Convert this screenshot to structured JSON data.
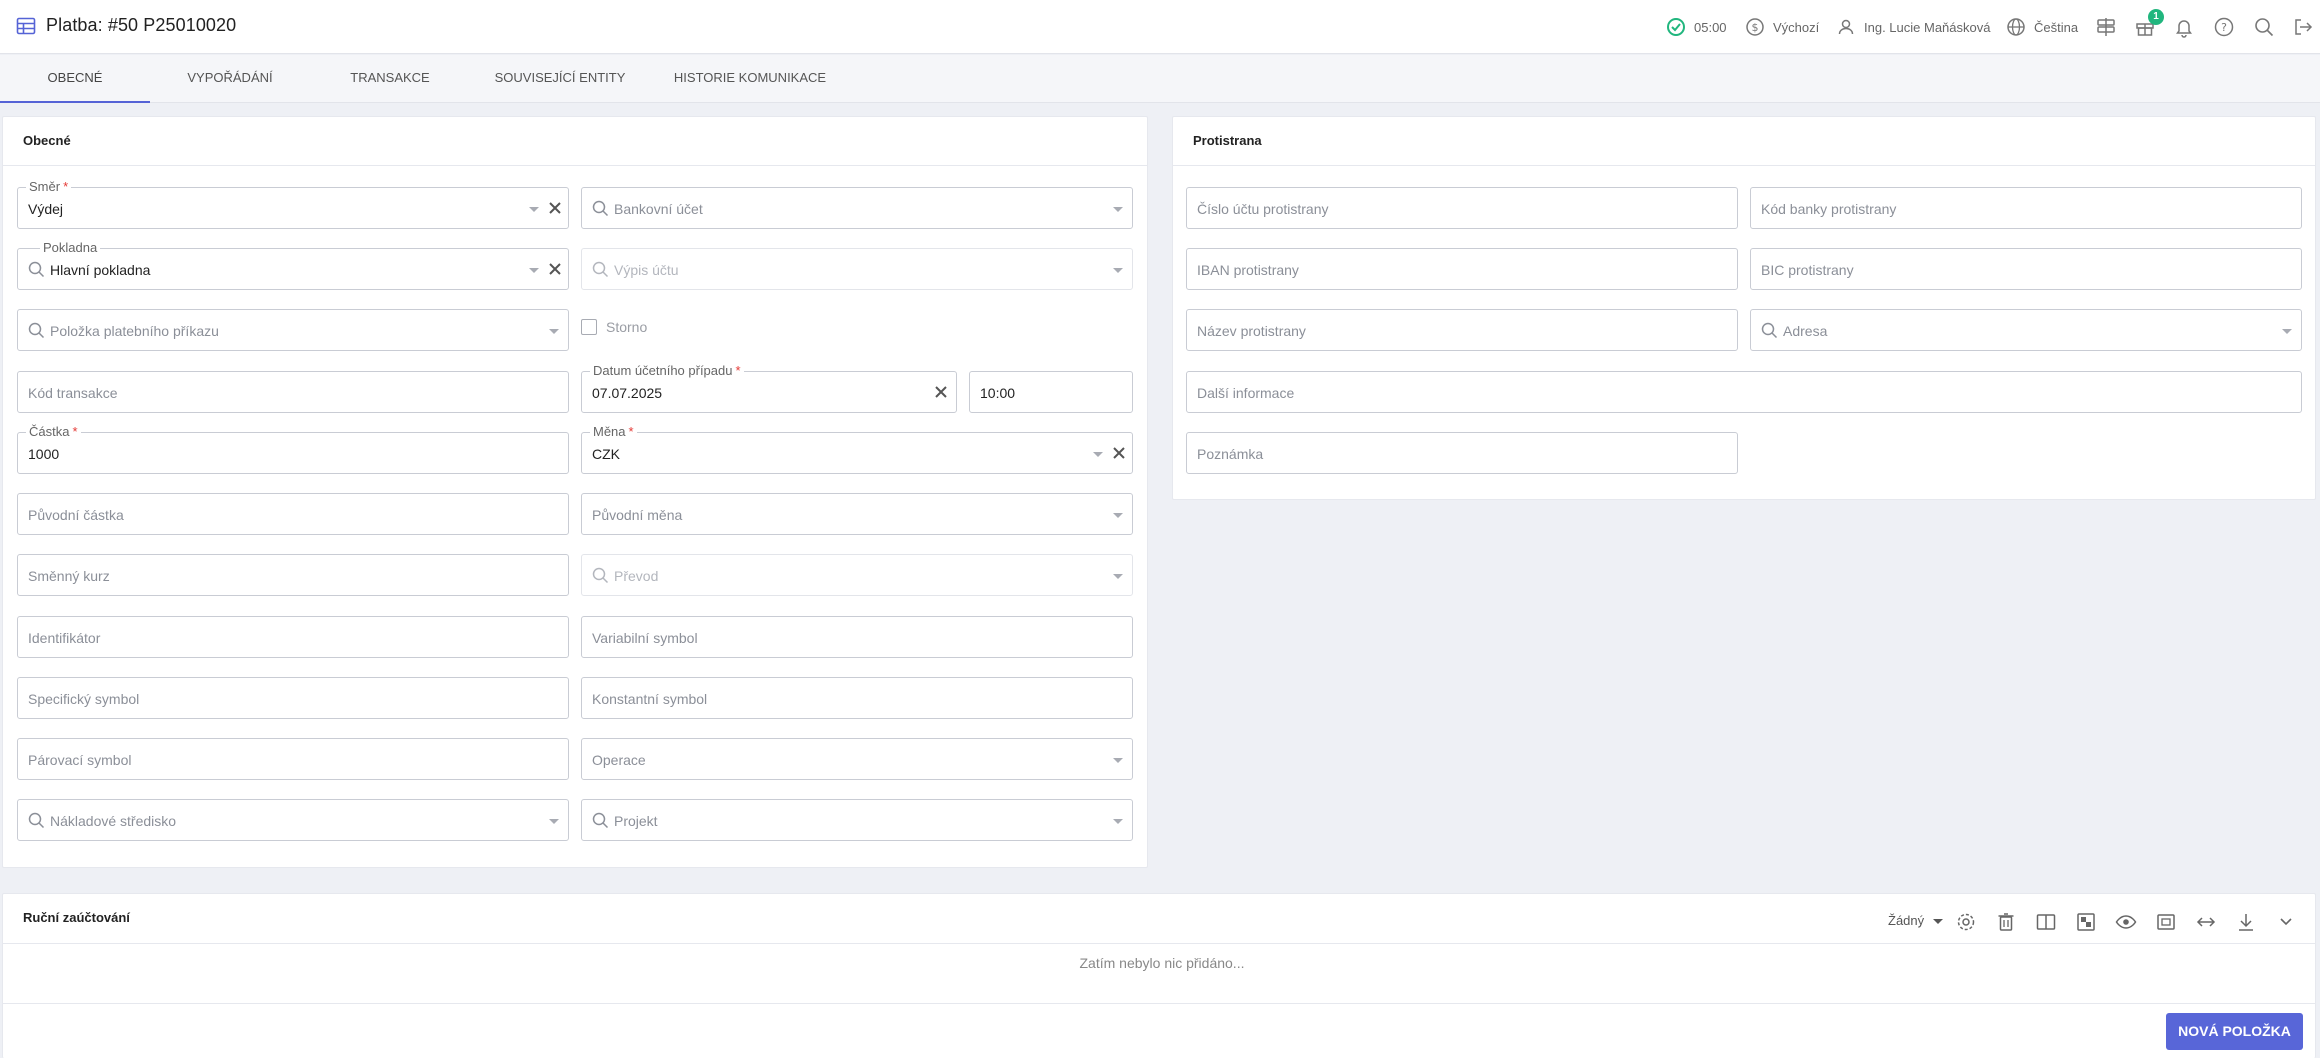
{
  "header": {
    "title": "Platba: #50 P25010020",
    "time": "05:00",
    "currency_profile": "Výchozí",
    "user": "Ing. Lucie Maňásková",
    "language": "Čeština",
    "gift_badge": "1"
  },
  "tabs": [
    {
      "label": "Obecné",
      "active": true
    },
    {
      "label": "Vypořádání",
      "active": false
    },
    {
      "label": "Transakce",
      "active": false
    },
    {
      "label": "Související entity",
      "active": false
    },
    {
      "label": "Historie komunikace",
      "active": false
    }
  ],
  "general": {
    "title": "Obecné",
    "smer": {
      "label": "Směr",
      "value": "Výdej"
    },
    "bankovni_ucet": {
      "placeholder": "Bankovní účet"
    },
    "pokladna": {
      "label": "Pokladna",
      "value": "Hlavní pokladna"
    },
    "vypis_uctu": {
      "placeholder": "Výpis účtu"
    },
    "polozka_prikazu": {
      "placeholder": "Položka platebního příkazu"
    },
    "storno": {
      "label": "Storno"
    },
    "kod_transakce": {
      "placeholder": "Kód transakce"
    },
    "datum": {
      "label": "Datum účetního případu",
      "value": "07.07.2025"
    },
    "cas": {
      "value": "10:00"
    },
    "castka": {
      "label": "Částka",
      "value": "1000"
    },
    "mena": {
      "label": "Měna",
      "value": "CZK"
    },
    "puvodni_castka": {
      "placeholder": "Původní částka"
    },
    "puvodni_mena": {
      "placeholder": "Původní měna"
    },
    "smenny_kurz": {
      "placeholder": "Směnný kurz"
    },
    "prevod": {
      "placeholder": "Převod"
    },
    "identifikator": {
      "placeholder": "Identifikátor"
    },
    "variabilni_symbol": {
      "placeholder": "Variabilní symbol"
    },
    "specificky_symbol": {
      "placeholder": "Specifický symbol"
    },
    "konstantni_symbol": {
      "placeholder": "Konstantní symbol"
    },
    "parovaci_symbol": {
      "placeholder": "Párovací symbol"
    },
    "operace": {
      "placeholder": "Operace"
    },
    "nakladove_stredisko": {
      "placeholder": "Nákladové středisko"
    },
    "projekt": {
      "placeholder": "Projekt"
    }
  },
  "counterparty": {
    "title": "Protistrana",
    "cislo_uctu": {
      "placeholder": "Číslo účtu protistrany"
    },
    "kod_banky": {
      "placeholder": "Kód banky protistrany"
    },
    "iban": {
      "placeholder": "IBAN protistrany"
    },
    "bic": {
      "placeholder": "BIC protistrany"
    },
    "nazev": {
      "placeholder": "Název protistrany"
    },
    "adresa": {
      "placeholder": "Adresa"
    },
    "dalsi_informace": {
      "placeholder": "Další informace"
    },
    "poznamka": {
      "placeholder": "Poznámka"
    }
  },
  "manual": {
    "title": "Ruční zaúčtování",
    "filter_value": "Žádný",
    "empty_message": "Zatím nebylo nic přidáno...",
    "new_item_button": "Nová položka"
  },
  "colors": {
    "accent": "#5866d8",
    "success": "#21b67e",
    "required": "#e53935"
  }
}
